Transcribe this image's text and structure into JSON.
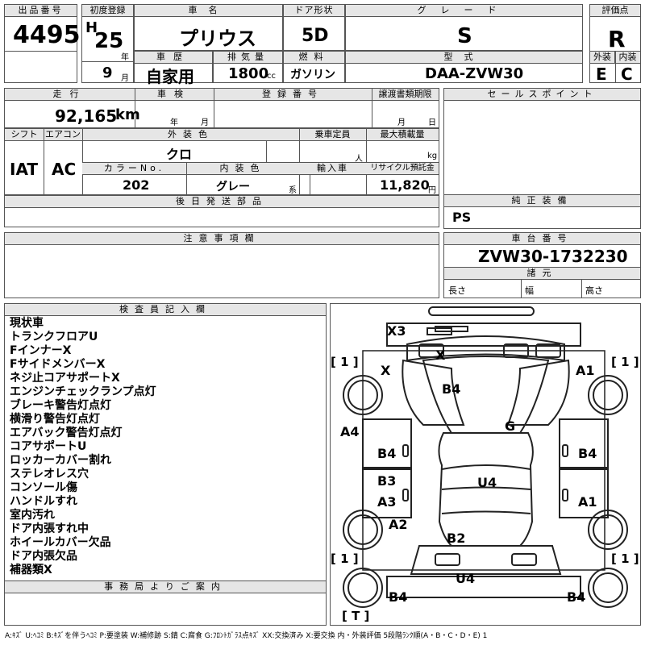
{
  "headers": {
    "lot": "出品番号",
    "first_reg": "初度登録",
    "car_name": "車名",
    "door": "ドア形状",
    "grade": "グレード",
    "rating": "評価点",
    "history": "車歴",
    "displacement": "排気量",
    "fuel": "燃料",
    "model": "型式",
    "exterior": "外装",
    "interior": "内装",
    "mileage": "走行",
    "shaken": "車検",
    "reg_no": "登録番号",
    "transfer": "譲渡書類期限",
    "sales_point": "セールスポイント",
    "shift": "シフト",
    "aircon": "エアコン",
    "ext_color": "外装色",
    "capacity": "乗車定員",
    "max_load": "最大積載量",
    "color_no": "カラーNo.",
    "int_color": "内装色",
    "import": "輸入車",
    "recycle": "リサイクル預託金",
    "later_parts": "後日発送部品",
    "equipment": "純正装備",
    "caution": "注意事項欄",
    "chassis": "車台番号",
    "specs": "諸元",
    "inspector": "検査員記入欄",
    "office": "事務局よりご案内"
  },
  "values": {
    "lot": "4495",
    "era": "H",
    "year": "25",
    "year_unit": "年",
    "month": "9",
    "month_unit": "月",
    "car_name": "プリウス",
    "door": "5D",
    "grade": "S",
    "rating": "R",
    "history": "自家用",
    "displacement": "1800",
    "displacement_unit": "cc",
    "fuel": "ガソリン",
    "model": "DAA-ZVW30",
    "exterior": "E",
    "interior": "C",
    "mileage": "92,165",
    "mileage_unit": "km",
    "shaken_year": "年",
    "shaken_month": "月",
    "transfer_month": "月",
    "transfer_day": "日",
    "shift": "IAT",
    "aircon": "AC",
    "ext_color": "クロ",
    "capacity_unit": "人",
    "load_unit": "kg",
    "color_no": "202",
    "int_color": "グレー",
    "int_color_unit": "系",
    "recycle": "11,820",
    "recycle_unit": "円",
    "equipment": "PS",
    "chassis": "ZVW30-1732230",
    "length": "長さ",
    "width": "幅",
    "height": "高さ"
  },
  "inspector_notes": [
    "現状車",
    "トランクフロアU",
    "FインナーX",
    "FサイドメンバーX",
    "ネジ止コアサポートX",
    "エンジンチェックランプ点灯",
    "ブレーキ警告灯点灯",
    "横滑り警告灯点灯",
    "エアバック警告灯点灯",
    "コアサポートU",
    "ロッカーカバー割れ",
    "ステレオレス穴",
    "コンソール傷",
    "ハンドルすれ",
    "室内汚れ",
    "ドア内張すれ中",
    "ホイールカバー欠品",
    "ドア内張欠品",
    "補器類X"
  ],
  "diagram_marks": {
    "x3": "X3",
    "x_top": "X",
    "x_left": "X",
    "a1_tr": "A1",
    "b4_hood": "B4",
    "g": "G",
    "a4": "A4",
    "b4_left": "B4",
    "b4_right": "B4",
    "b3": "B3",
    "u4_center": "U4",
    "a3": "A3",
    "a1_r": "A1",
    "a2": "A2",
    "b2": "B2",
    "u4_rear": "U4",
    "b4_bl": "B4",
    "b4_br": "B4",
    "tire_fl": "[ 1 ]",
    "tire_fr": "[ 1 ]",
    "tire_rl": "[ 1 ]",
    "tire_rr": "[ 1 ]",
    "trunk": "[ T ]"
  },
  "legend": "A:ｷｽﾞ U:ﾍｺﾐ B:ｷｽﾞを伴うﾍｺﾐ P:要塗装 W:補修跡 S:錆 C:腐食 G:ﾌﾛﾝﾄｶﾞﾗｽ点ｷｽﾞ XX:交換済み X:要交換 内・外装評価 5段階ﾗﾝｸ順(A・B・C・D・E) 1"
}
